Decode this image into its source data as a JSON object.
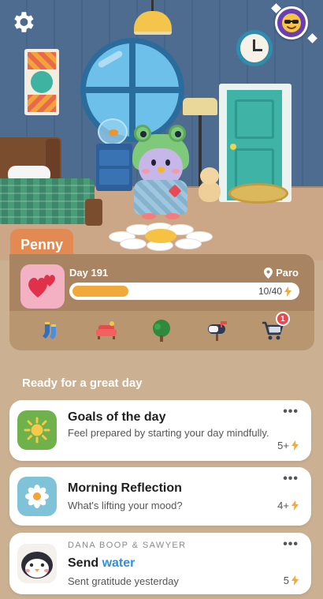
{
  "pet": {
    "name": "Penny",
    "day_label": "Day 191",
    "location": "Paro",
    "energy_current": 10,
    "energy_max": 40,
    "energy_text": "10/40",
    "progress_fraction": 0.25
  },
  "nav": {
    "items": [
      {
        "icon": "socks-icon",
        "label": ""
      },
      {
        "icon": "sofa-icon",
        "label": ""
      },
      {
        "icon": "tree-icon",
        "label": ""
      },
      {
        "icon": "mailbox-icon",
        "label": ""
      },
      {
        "icon": "shopping-cart-icon",
        "label": "",
        "badge": "1"
      }
    ]
  },
  "section": {
    "title": "Ready for a great day"
  },
  "tasks": [
    {
      "title": "Goals of the day",
      "subtitle": "Feel prepared by starting your day mindfully.",
      "points": "5+",
      "icon": "sun-icon"
    },
    {
      "title": "Morning Reflection",
      "subtitle": "What's lifting your mood?",
      "points": "4+",
      "icon": "daisy-icon"
    },
    {
      "overline": "DANA BOOP & SAWYER",
      "title_prefix": "Send",
      "title_accent": "water",
      "subtitle": "Sent gratitude yesterday",
      "points": "5",
      "icon": "penguin-face-icon"
    }
  ],
  "colors": {
    "wall": "#4b6a8e",
    "floor": "#cba787",
    "background": "#cbb192",
    "tab": "#e38a53",
    "progress": "#f2a93b",
    "energy_bolt": "#f2a93b",
    "accent_link": "#2f8fe0",
    "badge": "#e8484f"
  }
}
